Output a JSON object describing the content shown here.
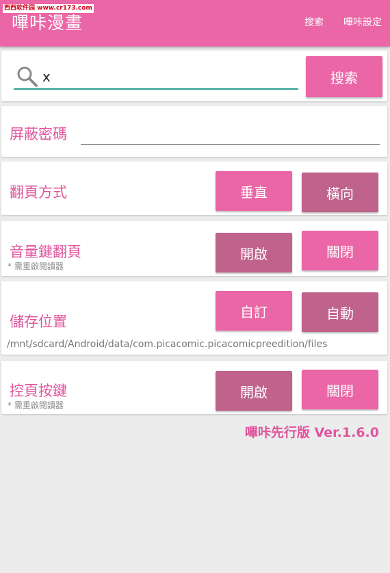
{
  "watermark": {
    "site": "西西软件园",
    "url": "www.cr173.com"
  },
  "app": {
    "title": "嗶咔漫畫"
  },
  "header": {
    "search_action": "搜索",
    "settings_action": "嗶咔設定"
  },
  "search": {
    "value": "x",
    "button_label": "搜索"
  },
  "password": {
    "label": "屏蔽密碼",
    "value": ""
  },
  "page_turn": {
    "label": "翻頁方式",
    "options": [
      "垂直",
      "橫向"
    ]
  },
  "volume_key": {
    "label": "音量鍵翻頁",
    "note": "* 需重啟閱讀器",
    "options": [
      "開啟",
      "關閉"
    ]
  },
  "storage": {
    "label": "儲存位置",
    "options": [
      "自訂",
      "自動"
    ],
    "path": "/mnt/sdcard/Android/data/com.picacomic.picacomicpreedition/files"
  },
  "control_key": {
    "label": "控頁按鍵",
    "note": "* 需重啟閱讀器",
    "options": [
      "開啟",
      "關閉"
    ]
  },
  "footer": {
    "version": "嗶咔先行版 Ver.1.6.0"
  },
  "colors": {
    "primary": "#ea66a6",
    "primary_dark": "#c0638c",
    "accent": "#2a9f8e",
    "text_pink": "#e0559d",
    "background": "#ececec"
  }
}
